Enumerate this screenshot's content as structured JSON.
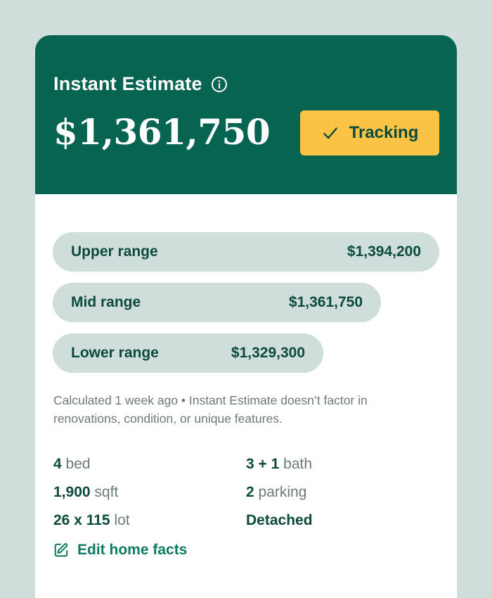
{
  "header": {
    "title": "Instant Estimate",
    "price": "$1,361,750",
    "tracking_label": "Tracking"
  },
  "ranges": [
    {
      "label": "Upper range",
      "value": "$1,394,200"
    },
    {
      "label": "Mid range",
      "value": "$1,361,750"
    },
    {
      "label": "Lower range",
      "value": "$1,329,300"
    }
  ],
  "note": "Calculated 1 week ago • Instant Estimate doesn’t factor in renovations, condition, or unique features.",
  "facts": {
    "beds": {
      "value": "4",
      "unit": "bed"
    },
    "baths": {
      "value": "3 + 1",
      "unit": "bath"
    },
    "sqft": {
      "value": "1,900",
      "unit": "sqft"
    },
    "parking": {
      "value": "2",
      "unit": "parking"
    },
    "lot": {
      "value": "26 x 115",
      "unit": "lot"
    },
    "type": {
      "value": "Detached"
    }
  },
  "edit_label": "Edit home facts",
  "colors": {
    "background": "#cfdedb",
    "header": "#066451",
    "accent": "#fbc345",
    "text_dark": "#0b4a3c",
    "link": "#0f7a62"
  },
  "icons": [
    "info-icon",
    "check-icon",
    "edit-icon"
  ]
}
